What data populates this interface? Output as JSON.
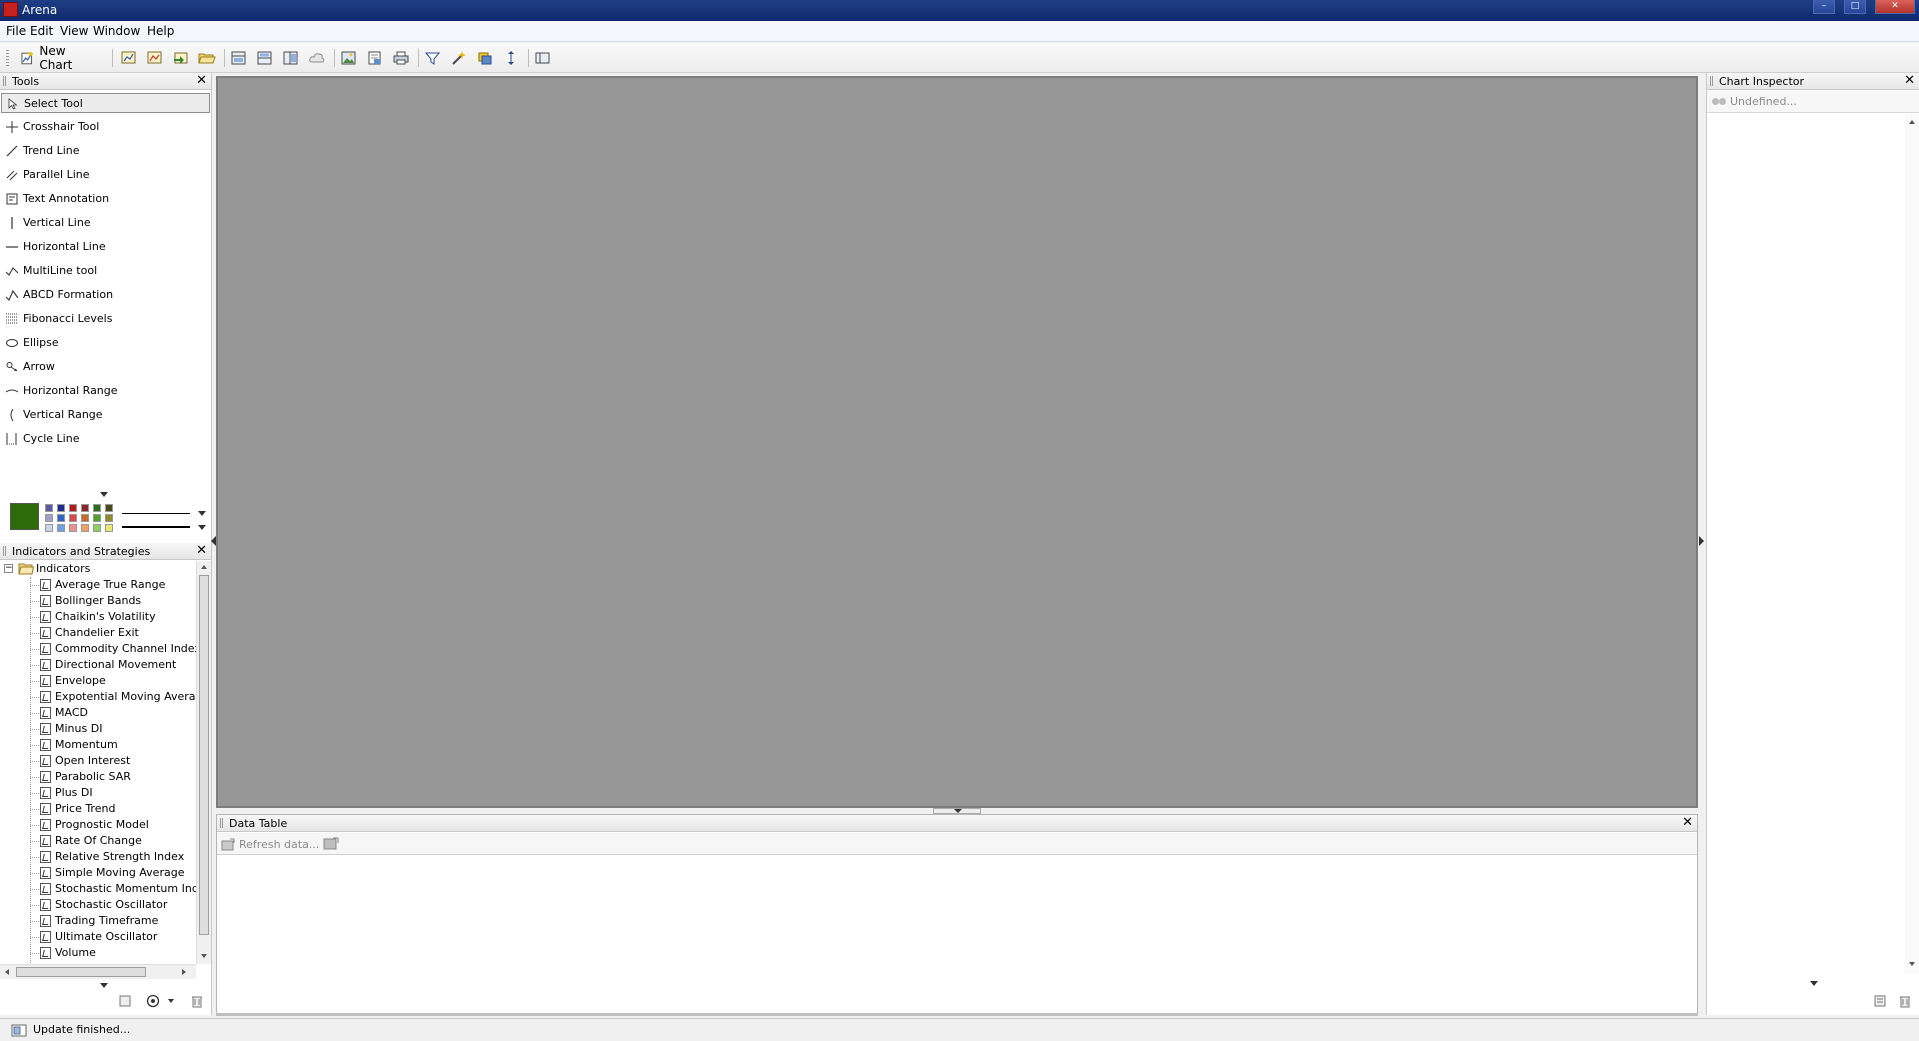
{
  "window": {
    "title": "Arena"
  },
  "menu": [
    "File",
    "Edit",
    "View",
    "Window",
    "Help"
  ],
  "toolbar": {
    "new_chart_label": "New Chart",
    "icons": [
      "open-chart-icon",
      "save-chart-icon",
      "import-icon",
      "open-folder-icon",
      "layout-1-icon",
      "layout-2-icon",
      "layout-3-icon",
      "cloud-icon",
      "image-icon",
      "export-icon",
      "print-icon",
      "filter-icon",
      "wand-icon",
      "highlight-icon",
      "sort-icon",
      "window-icon"
    ]
  },
  "tools_panel": {
    "title": "Tools",
    "items": [
      {
        "label": "Select Tool",
        "icon": "pointer-icon",
        "selected": true
      },
      {
        "label": "Crosshair Tool",
        "icon": "crosshair-icon"
      },
      {
        "label": "Trend Line",
        "icon": "trend-line-icon"
      },
      {
        "label": "Parallel Line",
        "icon": "parallel-line-icon"
      },
      {
        "label": "Text Annotation",
        "icon": "text-annotation-icon"
      },
      {
        "label": "Vertical Line",
        "icon": "vertical-line-icon"
      },
      {
        "label": "Horizontal Line",
        "icon": "horizontal-line-icon"
      },
      {
        "label": "MultiLine tool",
        "icon": "multiline-icon"
      },
      {
        "label": "ABCD Formation",
        "icon": "abcd-icon"
      },
      {
        "label": "Fibonacci Levels",
        "icon": "fibonacci-icon"
      },
      {
        "label": "Ellipse",
        "icon": "ellipse-icon"
      },
      {
        "label": "Arrow",
        "icon": "arrow-icon"
      },
      {
        "label": "Horizontal Range",
        "icon": "horizontal-range-icon"
      },
      {
        "label": "Vertical Range",
        "icon": "vertical-range-icon"
      },
      {
        "label": "Cycle Line",
        "icon": "cycle-line-icon"
      }
    ],
    "current_color": "#2e6a0a",
    "palette": [
      [
        "#5a5a9e",
        "#1e2f8f",
        "#b01c1c",
        "#8a2b2b",
        "#2d6e1c",
        "#4b4b1a"
      ],
      [
        "#a0a0c8",
        "#2f63c5",
        "#d84b4b",
        "#c86a2e",
        "#4ea12c",
        "#8c8c2a"
      ],
      [
        "#c8d4ec",
        "#6fa0e0",
        "#f09090",
        "#f0a060",
        "#8fd060",
        "#e8e870"
      ]
    ]
  },
  "indicators_panel": {
    "title": "Indicators and Strategies",
    "root": "Indicators",
    "items": [
      "Average True Range",
      "Bollinger Bands",
      "Chaikin's Volatility",
      "Chandelier Exit",
      "Commodity Channel Index",
      "Directional Movement",
      "Envelope",
      "Expotential Moving Average",
      "MACD",
      "Minus DI",
      "Momentum",
      "Open Interest",
      "Parabolic SAR",
      "Plus DI",
      "Price Trend",
      "Prognostic Model",
      "Rate Of Change",
      "Relative Strength Index",
      "Simple Moving Average",
      "Stochastic Momentum Index",
      "Stochastic Oscillator",
      "Trading Timeframe",
      "Ultimate Oscillator",
      "Volume"
    ]
  },
  "data_table": {
    "title": "Data Table",
    "refresh_label": "Refresh data..."
  },
  "inspector": {
    "title": "Chart Inspector",
    "value": "Undefined..."
  },
  "status": {
    "text": "Update finished..."
  }
}
